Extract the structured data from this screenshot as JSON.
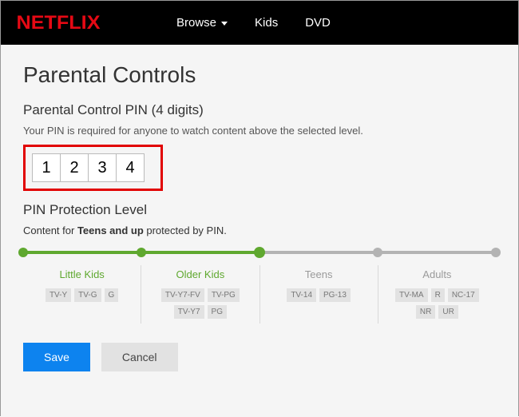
{
  "brand": "NETFLIX",
  "nav": {
    "browse": "Browse",
    "kids": "Kids",
    "dvd": "DVD"
  },
  "page_title": "Parental Controls",
  "pin_section_title": "Parental Control PIN (4 digits)",
  "pin_help": "Your PIN is required for anyone to watch content above the selected level.",
  "pin_digits": [
    "1",
    "2",
    "3",
    "4"
  ],
  "level_section_title": "PIN Protection Level",
  "protection_prefix": "Content for ",
  "protection_level": "Teens and up",
  "protection_suffix": " protected by PIN.",
  "slider": {
    "selected_index": 2,
    "stops": 5
  },
  "levels": [
    {
      "name": "Little Kids",
      "active": true,
      "ratings": [
        "TV-Y",
        "TV-G",
        "G"
      ]
    },
    {
      "name": "Older Kids",
      "active": true,
      "ratings": [
        "TV-Y7-FV",
        "TV-PG",
        "TV-Y7",
        "PG"
      ]
    },
    {
      "name": "Teens",
      "active": false,
      "ratings": [
        "TV-14",
        "PG-13"
      ]
    },
    {
      "name": "Adults",
      "active": false,
      "ratings": [
        "TV-MA",
        "R",
        "NC-17",
        "NR",
        "UR"
      ]
    }
  ],
  "buttons": {
    "save": "Save",
    "cancel": "Cancel"
  }
}
